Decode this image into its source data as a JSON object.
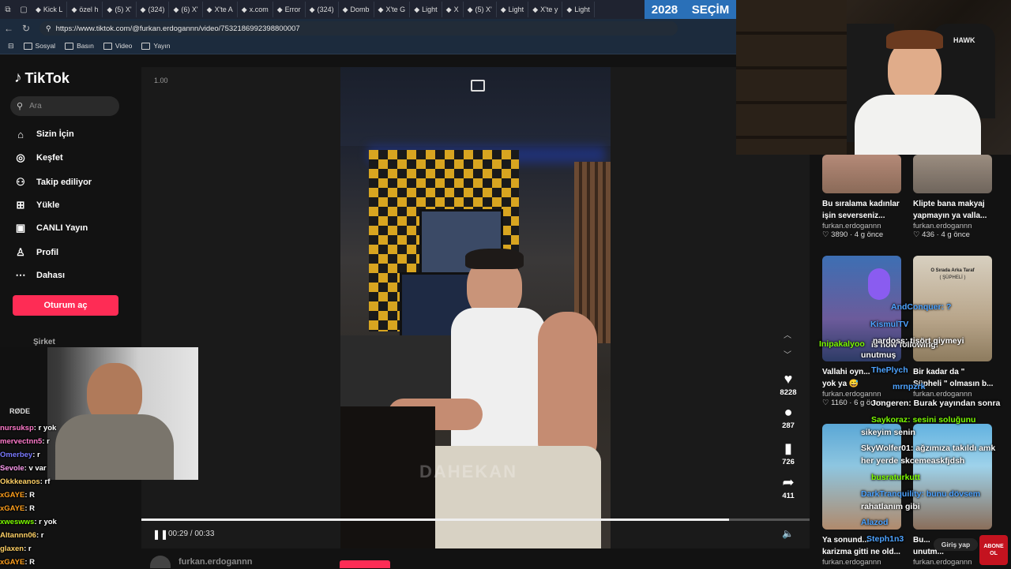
{
  "browser": {
    "tabs": [
      "Kick L",
      "özel h",
      "(5) X'",
      "(324)",
      "(6) X'",
      "X'te A",
      "x.com",
      "Error",
      "(324)",
      "Domb",
      "X'te G",
      "Light",
      "X",
      "(5) X'",
      "Light",
      "X'te y",
      "Light"
    ],
    "url": "https://www.tiktok.com/@furkan.erdogannn/video/7532186992398800007",
    "bookmarks": [
      "Sosyal",
      "Basın",
      "Video",
      "Yayın"
    ]
  },
  "badge": {
    "year": "2028",
    "word": "SEÇİM"
  },
  "tiktok": {
    "logo": "TikTok",
    "search_placeholder": "Ara",
    "nav": [
      "Sizin İçin",
      "Keşfet",
      "Takip ediliyor",
      "Yükle",
      "CANLI Yayın",
      "Profil",
      "Dahası"
    ],
    "login": "Oturum aç",
    "company": "Şirket",
    "speed": "1.00",
    "time": "00:29 / 00:33",
    "progress": 0.88,
    "likes": "8228",
    "comments": "287",
    "saves": "726",
    "shares": "411",
    "author": "furkan.erdogannn",
    "video_watermark": "DAHEKAN"
  },
  "related": [
    {
      "caption1": "Bu sıralama kadınlar",
      "caption2": "işin severseniz...",
      "author": "furkan.erdogannn",
      "likes": "3890",
      "age": "4 g önce"
    },
    {
      "caption1": "Klipte bana makyaj",
      "caption2": "yapmayın ya valla...",
      "author": "furkan.erdogannn",
      "likes": "436",
      "age": "4 g önce"
    },
    {
      "caption1": "Vallahi oyn...",
      "caption2": "yok ya 😅",
      "author": "furkan.erdogannn",
      "likes": "1160",
      "age": "6 g önce"
    },
    {
      "caption1": "Bir kadar da \"",
      "caption2": "Şüpheli \" olmasın b...",
      "author": "furkan.erdogannn",
      "likes": "",
      "age": ""
    },
    {
      "caption1": "Ya sonund...",
      "caption2": "karizma gitti ne old...",
      "author": "furkan.erdogannn",
      "likes": "",
      "age": ""
    },
    {
      "caption1": "Bu...",
      "caption2": "unutm...",
      "author": "furkan.erdogannn",
      "likes": "",
      "age": ""
    }
  ],
  "thumb_text": {
    "banner": "O Sırada Arka Taraf",
    "sub": "( ŞÜPHELİ )"
  },
  "chat_left": [
    {
      "user": "nursuksp",
      "msg": ": r yok",
      "color": "#ff7acb"
    },
    {
      "user": "mervectnn5",
      "msg": ": r",
      "color": "#ff7acb"
    },
    {
      "user": "Omerbey",
      "msg": ": r",
      "color": "#7a7aff"
    },
    {
      "user": "Sevole",
      "msg": ": v var",
      "color": "#ff9cf0"
    },
    {
      "user": "Okkkeanos",
      "msg": ": rf",
      "color": "#ffd166"
    },
    {
      "user": "xGAYE",
      "msg": ": R",
      "color": "#ff9f1c"
    },
    {
      "user": "xGAYE",
      "msg": ": R",
      "color": "#ff9f1c"
    },
    {
      "user": "xweswws",
      "msg": ": r yok",
      "color": "#7CFC00"
    },
    {
      "user": "Altannn06",
      "msg": ": r",
      "color": "#ffd166"
    },
    {
      "user": "glaxen",
      "msg": ": r",
      "color": "#ffd166"
    },
    {
      "user": "xGAYE",
      "msg": ": R",
      "color": "#ff9f1c"
    }
  ],
  "chat_right": [
    {
      "text": "AndConquer: ?",
      "color": "#4da3ff"
    },
    {
      "text": "KismulTV",
      "color": "#4da3ff"
    },
    {
      "text": "is now following!",
      "color": "#ffffff"
    },
    {
      "text": "Inipakalyoo",
      "color": "#7CFC00"
    },
    {
      "text": "unutmuş",
      "color": "#ffffff"
    },
    {
      "text": "nardoss: tişört giymeyi",
      "color": "#ffffff"
    },
    {
      "text": "ThePlych",
      "color": "#4da3ff"
    },
    {
      "text": "mrnpzrk",
      "color": "#4da3ff"
    },
    {
      "text": "Jongeren: Burak yayından sonra",
      "color": "#ffffff"
    },
    {
      "text": "Saykoraz: sesini soluğunu",
      "color": "#7CFC00"
    },
    {
      "text": "sikeyim senin",
      "color": "#ffffff"
    },
    {
      "text": "SkyWolfer01: ağzımıza takıldı amk",
      "color": "#ffffff"
    },
    {
      "text": "her yerde skcemeaskfjdsh",
      "color": "#ffffff"
    },
    {
      "text": "busraturkutt",
      "color": "#7CFC00"
    },
    {
      "text": "DarkTranquility: bunu dövsem",
      "color": "#4da3ff"
    },
    {
      "text": "rahatlanım gibi",
      "color": "#ffffff"
    },
    {
      "text": "Alazod",
      "color": "#4da3ff"
    },
    {
      "text": "Steph1n3",
      "color": "#4da3ff"
    },
    {
      "text": "Giriş yap",
      "color": "#dddddd"
    }
  ],
  "mic_label": "RØDE",
  "abone": "ABONE OL",
  "hawk": "HAWK"
}
